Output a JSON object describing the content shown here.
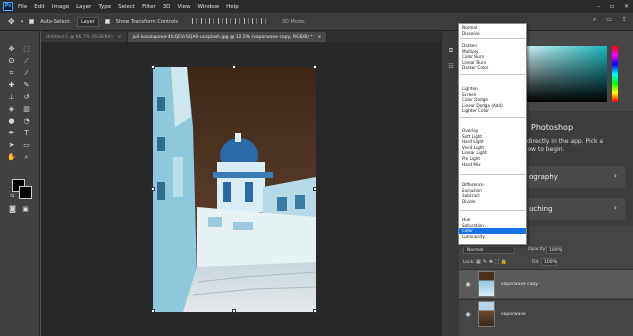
{
  "menubar": {
    "logo": "Ps",
    "items": [
      "File",
      "Edit",
      "Image",
      "Layer",
      "Type",
      "Select",
      "Filter",
      "3D",
      "View",
      "Window",
      "Help"
    ],
    "window_controls": [
      "–",
      "▫",
      "✕"
    ]
  },
  "options": {
    "auto_select_label": "Auto-Select:",
    "auto_select_value": "Layer",
    "transform_label": "Show Transform Controls",
    "mode3d_label": "3D Mode:"
  },
  "tabs": [
    {
      "label": "Untitled-1 @ 66.7% (RGB/8#)",
      "close": "×"
    },
    {
      "label": "juli-kosolapova-4fcQEVrSQA0-unsplash.jpg @ 12.5% (vaporwave copy, RGB/8) *",
      "close": "×"
    }
  ],
  "learn_panel": {
    "heading": "Photoshop",
    "text_line1": "s directly in the app. Pick a",
    "text_line2": "elow to begin.",
    "card1": "ography",
    "card2": "uching",
    "chevron": "›"
  },
  "layers_panel": {
    "blend_value": "Normal",
    "opacity_label": "Opacity:",
    "opacity_value": "100%",
    "lock_label": "Lock:",
    "fill_label": "Fill:",
    "fill_value": "100%",
    "layers": [
      {
        "name": "vaporwave copy"
      },
      {
        "name": "vaporwave"
      }
    ]
  },
  "blend_menu": {
    "items": [
      "Normal",
      "Dissolve",
      "Darken",
      "Multiply",
      "Color Burn",
      "Linear Burn",
      "Darker Color",
      "Lighten",
      "Screen",
      "Color Dodge",
      "Linear Dodge (Add)",
      "Lighter Color",
      "Overlay",
      "Soft Light",
      "Hard Light",
      "Vivid Light",
      "Linear Light",
      "Pin Light",
      "Hard Mix",
      "Difference",
      "Exclusion",
      "Subtract",
      "Divide",
      "Hue",
      "Saturation",
      "Color",
      "Luminosity"
    ],
    "selected": "Color"
  }
}
